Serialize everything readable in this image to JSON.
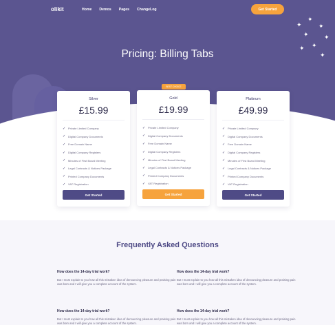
{
  "nav": {
    "logo": "olikit",
    "links": [
      "Home",
      "Demos",
      "Pages",
      "ChangeLog"
    ],
    "cta": "Get Started"
  },
  "hero": {
    "title": "Pricing: Billing Tabs"
  },
  "plans": [
    {
      "name": "Silver",
      "price": "£15.99",
      "button": "Get Started",
      "features": [
        "Private Limited Company",
        "Digital Company Documents",
        "Free Domain Name",
        "Digital Company Registers",
        "Minutes of First Board Meeting",
        "Legal Contracts & Notices Package",
        "Printed Company Documents",
        "VAT Registration"
      ]
    },
    {
      "name": "Gold",
      "badge": "BEST CHOICE",
      "price": "£19.99",
      "button": "Get Started",
      "features": [
        "Private Limited Company",
        "Digital Company Documents",
        "Free Domain Name",
        "Digital Company Registers",
        "Minutes of First Board Meeting",
        "Legal Contracts & Notices Package",
        "Printed Company Documents",
        "VAT Registration"
      ]
    },
    {
      "name": "Platinum",
      "price": "£49.99",
      "button": "Get Started",
      "features": [
        "Private Limited Company",
        "Digital Company Documents",
        "Free Domain Name",
        "Digital Company Registers",
        "Minutes of First Board Meeting",
        "Legal Contracts & Notices Package",
        "Printed Company Documents",
        "VAT Registration"
      ]
    }
  ],
  "faq": {
    "title": "Frequently Asked Questions",
    "items": [
      {
        "q": "How does the 14-day trial work?",
        "a": "But I must explain to you how all this mistaken idea of denouncing pleasure and praising pain was born and I will give you a complete account of the system."
      },
      {
        "q": "How does the 14-day trial work?",
        "a": "But I must explain to you how all this mistaken idea of denouncing pleasure and praising pain was born and I will give you a complete account of the system."
      },
      {
        "q": "How does the 14-day trial work?",
        "a": "But I must explain to you how all this mistaken idea of denouncing pleasure and praising pain was born and I will give you a complete account of the system."
      },
      {
        "q": "How does the 14-day trial work?",
        "a": "But I must explain to you how all this mistaken idea of denouncing pleasure and praising pain was born and I will give you a complete account of the system."
      }
    ]
  },
  "colors": {
    "primary": "#5b5590",
    "accent": "#f6a33d",
    "button": "#4f4b86"
  }
}
